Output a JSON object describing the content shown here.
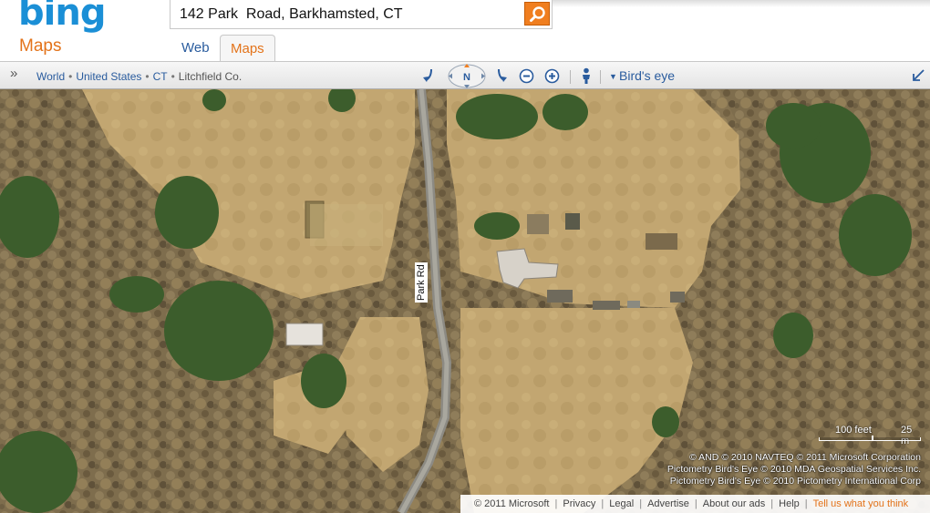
{
  "brand": {
    "logo": "bing",
    "product": "Maps"
  },
  "search": {
    "query": "142 Park  Road, Barkhamsted, CT",
    "button_icon": "search-icon"
  },
  "tabs": [
    {
      "label": "Web",
      "active": false
    },
    {
      "label": "Maps",
      "active": true
    }
  ],
  "breadcrumb": {
    "items": [
      "World",
      "United States",
      "CT",
      "Litchfield Co."
    ],
    "separator": "•"
  },
  "map_controls": {
    "compass_label": "N",
    "view_mode": "Birds eye",
    "view_mode_display": "Bird's eye"
  },
  "map": {
    "road_label": "Park Rd",
    "scale": {
      "feet": "100 feet",
      "meters": "25 m"
    },
    "attribution": [
      "© AND  © 2010 NAVTEQ   © 2011 Microsoft Corporation",
      "Pictometry Bird's Eye © 2010 MDA Geospatial Services Inc.",
      "Pictometry Bird's Eye © 2010 Pictometry International Corp"
    ]
  },
  "footer": {
    "copyright": "© 2011 Microsoft",
    "links": [
      "Privacy",
      "Legal",
      "Advertise",
      "About our ads",
      "Help"
    ],
    "feedback": "Tell us what you think"
  },
  "colors": {
    "brand_blue": "#1b8fd6",
    "accent_orange": "#e3731a",
    "link_blue": "#2a5c9e"
  }
}
